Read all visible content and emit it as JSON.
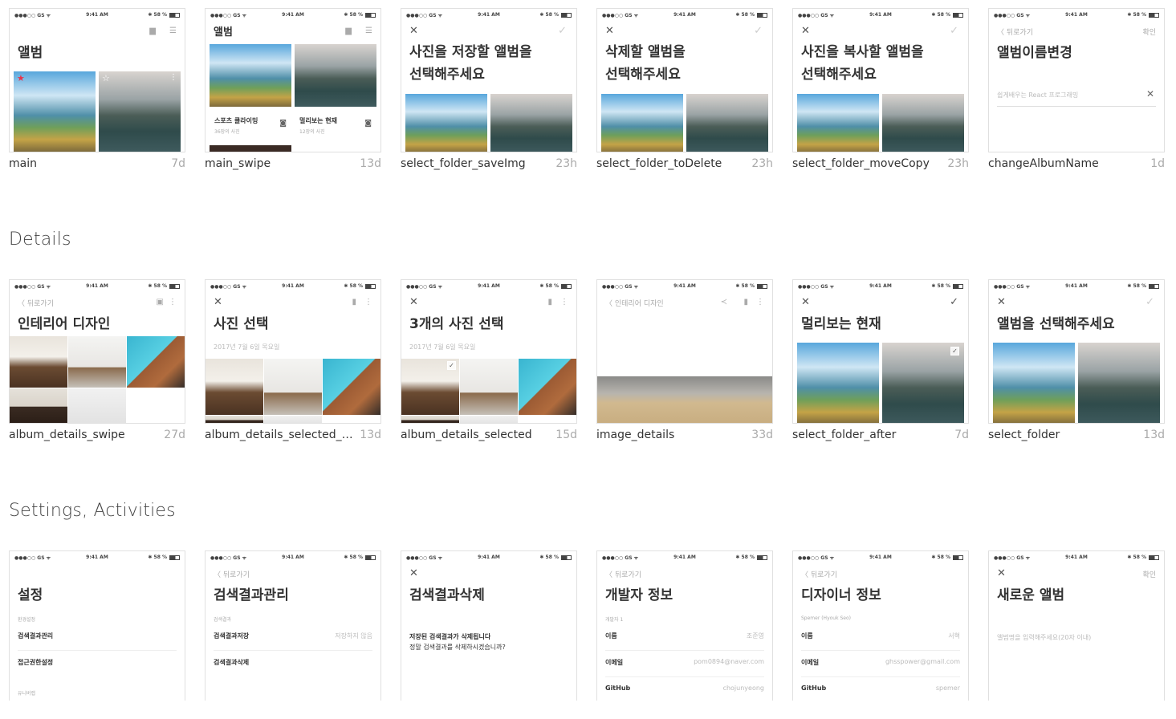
{
  "status_bar": {
    "carrier": "●●●○○ GS ᯤ",
    "time": "9:41 AM",
    "battery": "✱ 58 %"
  },
  "common": {
    "back_label": "〈 뒤로가기",
    "confirm_label": "확인",
    "close_glyph": "✕",
    "check_glyph": "✓"
  },
  "sections": [
    {
      "title": ""
    },
    {
      "title": "Details"
    },
    {
      "title": "Settings, Activities"
    }
  ],
  "row1": [
    {
      "name": "main",
      "age": "7d",
      "screen_title": "앨범"
    },
    {
      "name": "main_swipe",
      "age": "13d",
      "screen_title": "앨범",
      "albums": [
        {
          "name": "스포츠 클라이밍",
          "count": "36장의 사진"
        },
        {
          "name": "멀리보는 현재",
          "count": "12장의 사진"
        }
      ]
    },
    {
      "name": "select_folder_saveImg",
      "age": "23h",
      "screen_title": "사진을 저장할 앨범을\n선택해주세요"
    },
    {
      "name": "select_folder_toDelete",
      "age": "23h",
      "screen_title": "삭제할 앨범을\n선택해주세요"
    },
    {
      "name": "select_folder_moveCopy",
      "age": "23h",
      "screen_title": "사진을 복사할 앨범을\n선택해주세요"
    },
    {
      "name": "changeAlbumName",
      "age": "1d",
      "screen_title": "앨범이름변경",
      "field_value": "쉽게배우는 React 프로그래밍"
    }
  ],
  "row2": [
    {
      "name": "album_details_swipe",
      "age": "27d",
      "screen_title": "인테리어 디자인"
    },
    {
      "name": "album_details_selected_be..",
      "age": "13d",
      "screen_title": "사진 선택",
      "date": "2017년 7월 6일 목요일"
    },
    {
      "name": "album_details_selected",
      "age": "15d",
      "screen_title": "3개의 사진 선택",
      "date": "2017년 7월 6일 목요일"
    },
    {
      "name": "image_details",
      "age": "33d",
      "back_label": "〈 인테리어 디자인"
    },
    {
      "name": "select_folder_after",
      "age": "7d",
      "screen_title": "멀리보는 현재"
    },
    {
      "name": "select_folder",
      "age": "13d",
      "screen_title": "앨범을 선택해주세요"
    }
  ],
  "row3": [
    {
      "name": "",
      "age": "",
      "screen_title": "설정",
      "group": "환경설정",
      "items": [
        "검색결과관리",
        "접근권한설정",
        "유니버랩"
      ]
    },
    {
      "name": "",
      "age": "",
      "screen_title": "검색결과관리",
      "group": "검색결과",
      "items": [
        {
          "k": "검색결과저장",
          "v": "저장하지 않음"
        },
        {
          "k": "검색결과삭제",
          "v": ""
        }
      ]
    },
    {
      "name": "",
      "age": "",
      "screen_title": "검색결과삭제",
      "msg1": "저장된 검색결과가 삭제됩니다",
      "msg2": "정말 검색결과를 삭제하시겠습니까?"
    },
    {
      "name": "",
      "age": "",
      "screen_title": "개발자 정보",
      "group": "개발자 1",
      "items": [
        {
          "k": "이름",
          "v": "조준영"
        },
        {
          "k": "이메일",
          "v": "pom0894@naver.com"
        },
        {
          "k": "GitHub",
          "v": "chojunyeong"
        }
      ]
    },
    {
      "name": "",
      "age": "",
      "screen_title": "디자이너 정보",
      "group": "Spemer (Hyouk Seo)",
      "items": [
        {
          "k": "이름",
          "v": "서혁"
        },
        {
          "k": "이메일",
          "v": "ghsspower@gmail.com"
        },
        {
          "k": "GitHub",
          "v": "spemer"
        }
      ]
    },
    {
      "name": "",
      "age": "",
      "screen_title": "새로운 앨범",
      "placeholder": "앨범명을 입력해주세요(20자 이내)"
    }
  ],
  "colors": {
    "accent_star": "#e8334a",
    "muted": "#aaaaaa",
    "border": "#e0e0e0"
  },
  "icons": [
    "folder-add-icon",
    "sort-icon",
    "close-icon",
    "check-icon",
    "back-chevron-icon",
    "star-icon",
    "more-icon",
    "camera-icon",
    "trash-icon",
    "share-icon",
    "add-photo-icon"
  ]
}
